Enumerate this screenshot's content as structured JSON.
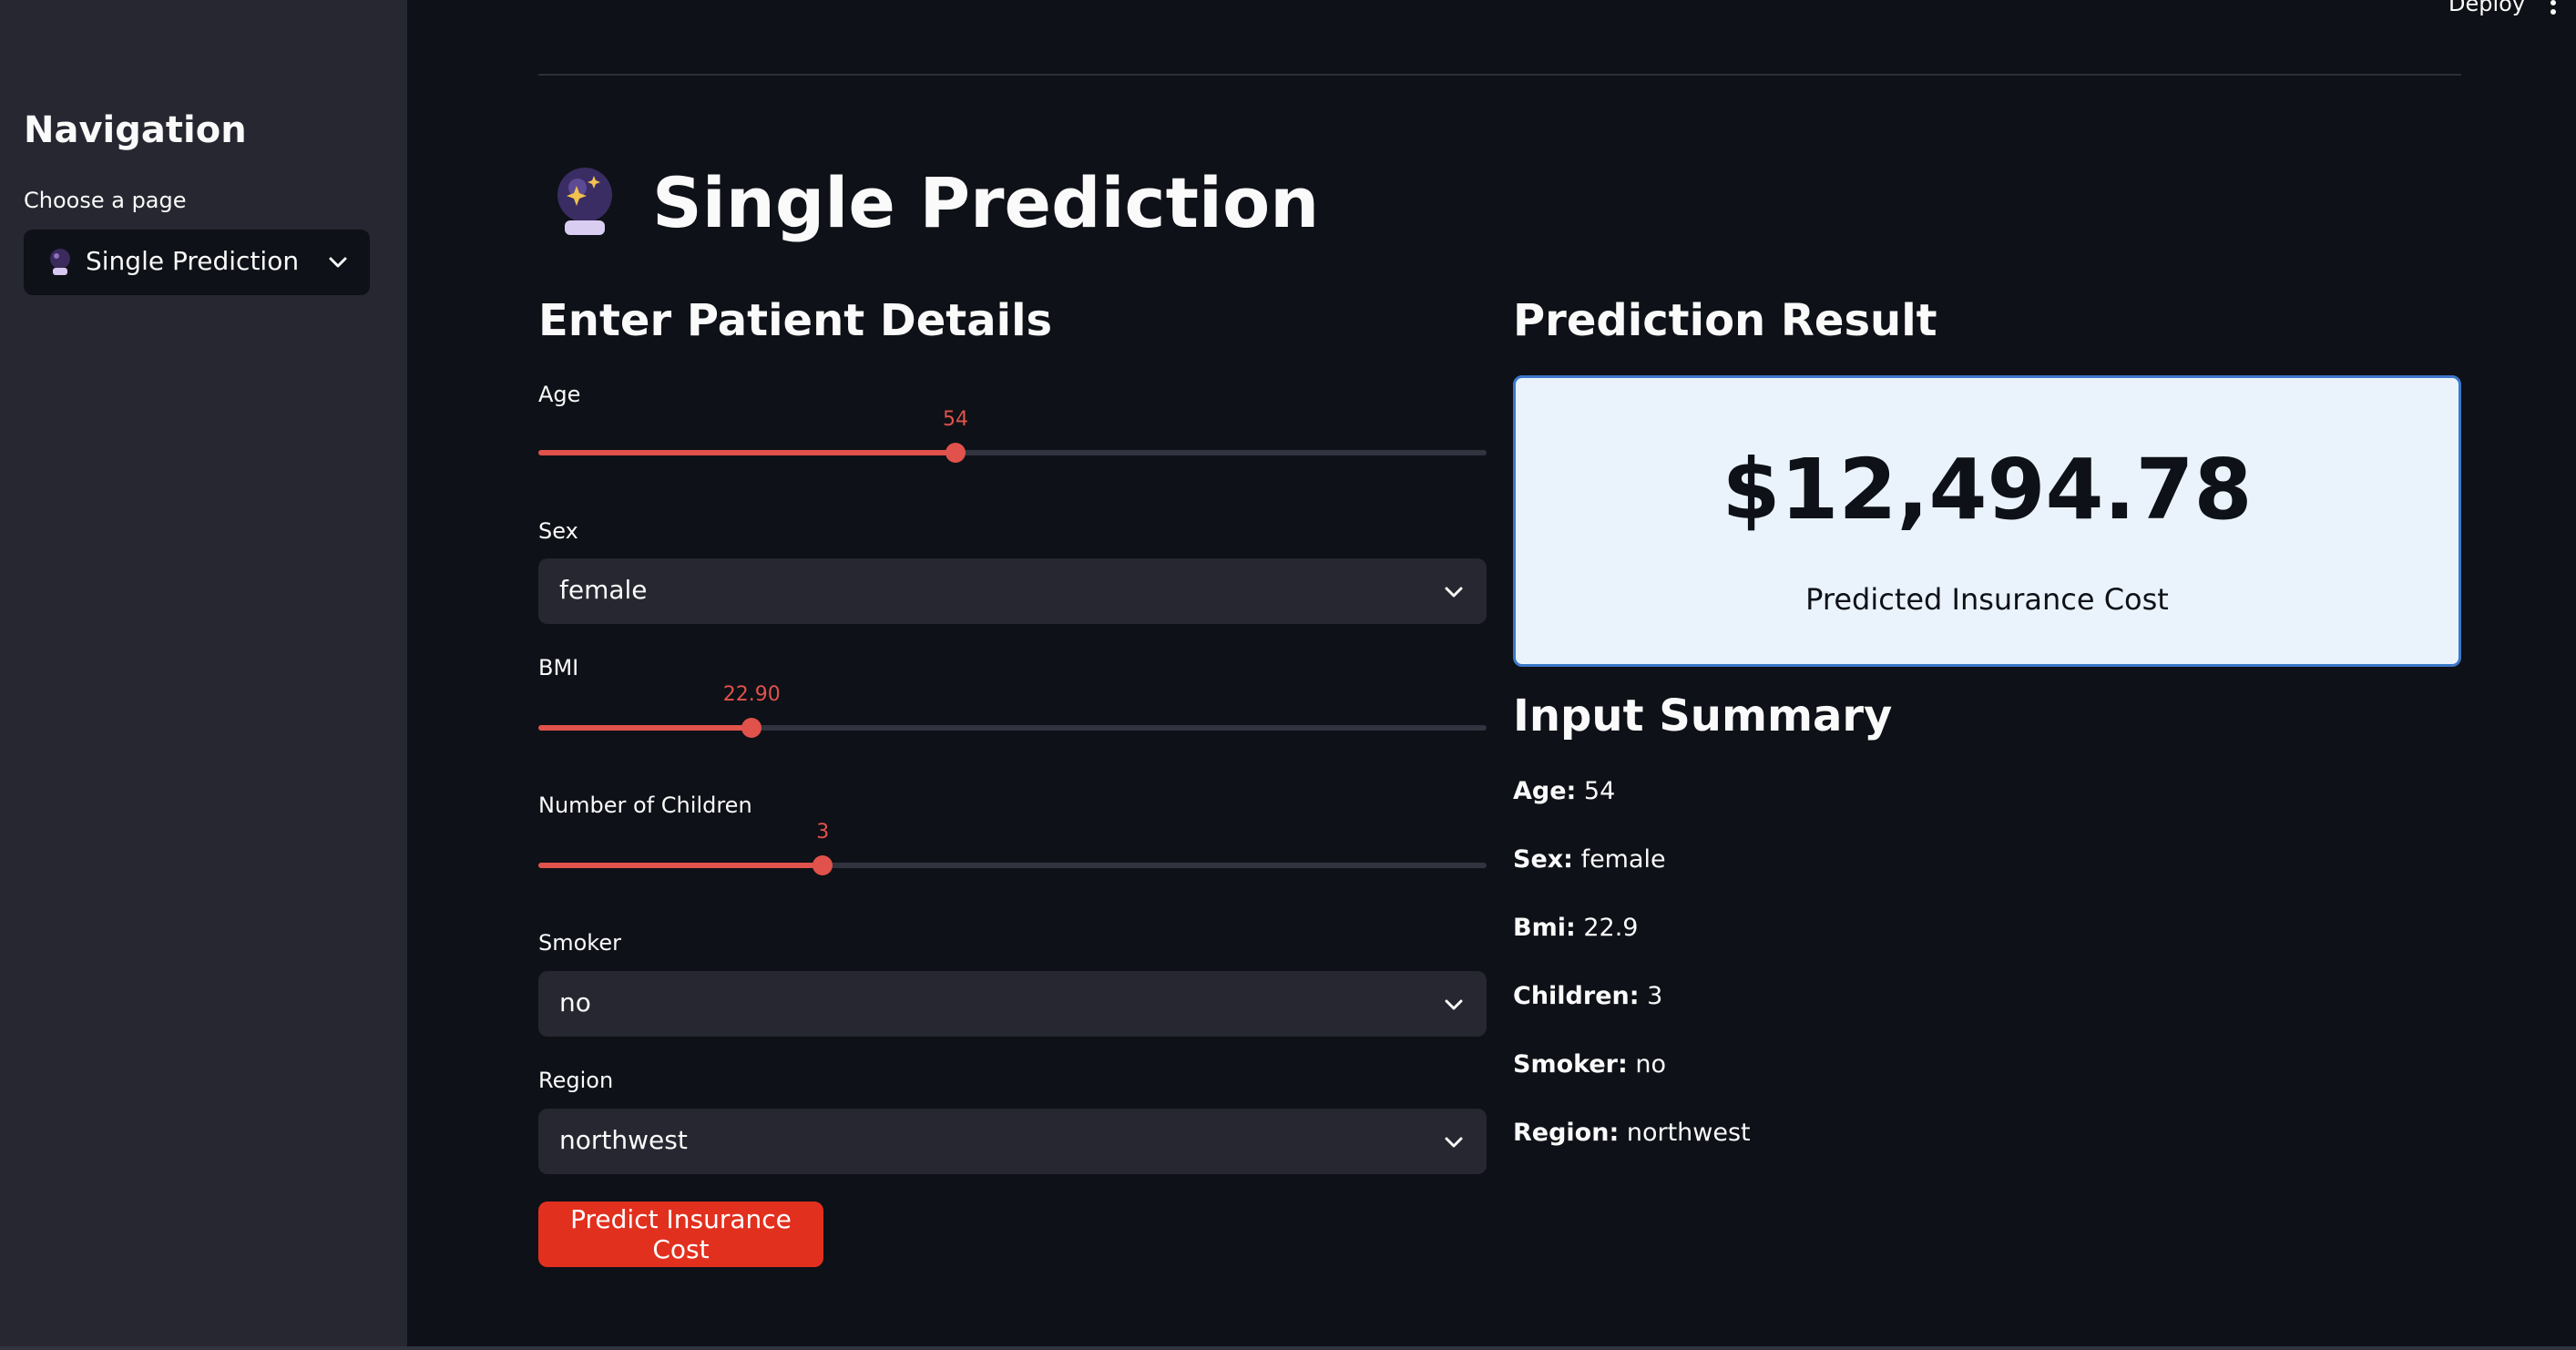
{
  "topbar": {
    "deploy_label": "Deploy",
    "menu_icon": "kebab-menu-icon"
  },
  "sidebar": {
    "title": "Navigation",
    "page_select_label": "Choose a page",
    "page_select_value": "Single Prediction",
    "page_select_icon": "crystal-ball-icon"
  },
  "main": {
    "title": "Single Prediction",
    "title_icon": "crystal-ball-icon",
    "form_heading": "Enter Patient Details",
    "result_heading": "Prediction Result",
    "summary_heading": "Input Summary"
  },
  "form": {
    "age": {
      "label": "Age",
      "value": "54",
      "fraction": 0.44
    },
    "sex": {
      "label": "Sex",
      "value": "female"
    },
    "bmi": {
      "label": "BMI",
      "value": "22.90",
      "fraction": 0.225
    },
    "children": {
      "label": "Number of Children",
      "value": "3",
      "fraction": 0.3
    },
    "smoker": {
      "label": "Smoker",
      "value": "no"
    },
    "region": {
      "label": "Region",
      "value": "northwest"
    },
    "predict_button": "Predict Insurance Cost"
  },
  "result": {
    "amount": "$12,494.78",
    "caption": "Predicted Insurance Cost"
  },
  "summary": [
    {
      "key": "Age:",
      "value": " 54"
    },
    {
      "key": "Sex:",
      "value": " female"
    },
    {
      "key": "Bmi:",
      "value": " 22.9"
    },
    {
      "key": "Children:",
      "value": " 3"
    },
    {
      "key": "Smoker:",
      "value": " no"
    },
    {
      "key": "Region:",
      "value": " northwest"
    }
  ],
  "colors": {
    "background": "#0e1117",
    "sidebar": "#262730",
    "accent": "#e0524b",
    "button": "#e2301f",
    "result_card": "#eaf3fc",
    "result_border": "#3b78c8"
  }
}
